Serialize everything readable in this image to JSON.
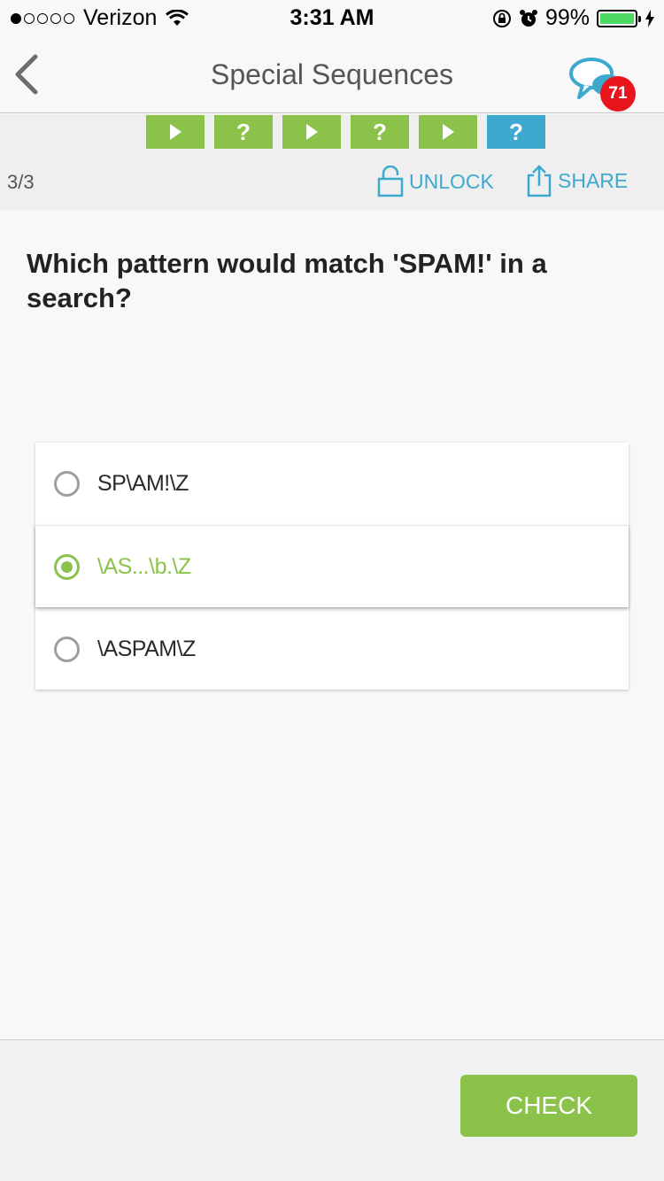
{
  "status_bar": {
    "carrier": "Verizon",
    "signal_bars_filled": 1,
    "signal_bars_total": 5,
    "time": "3:31 AM",
    "battery_percent": "99%",
    "battery_level": 0.99
  },
  "nav": {
    "title": "Special Sequences",
    "back_icon": "chevron-left-icon",
    "chat_icon": "chat-bubbles-icon",
    "badge_count": "71"
  },
  "progress": {
    "steps": [
      {
        "type": "play",
        "label": ""
      },
      {
        "type": "quiz",
        "label": "?"
      },
      {
        "type": "play",
        "label": ""
      },
      {
        "type": "quiz",
        "label": "?"
      },
      {
        "type": "play",
        "label": ""
      },
      {
        "type": "quiz",
        "label": "?",
        "active": true
      }
    ],
    "counter": "3/3",
    "unlock_label": "UNLOCK",
    "share_label": "SHARE"
  },
  "question": {
    "text": "Which pattern would match 'SPAM!' in a search?"
  },
  "options": [
    {
      "label": "SP\\AM!\\Z",
      "selected": false
    },
    {
      "label": "\\AS...\\b.\\Z",
      "selected": true
    },
    {
      "label": "\\ASPAM\\Z",
      "selected": false
    }
  ],
  "footer": {
    "check_label": "CHECK"
  },
  "colors": {
    "accent_green": "#8bc34a",
    "accent_blue": "#3ea9cf",
    "badge_red": "#e8161c"
  }
}
